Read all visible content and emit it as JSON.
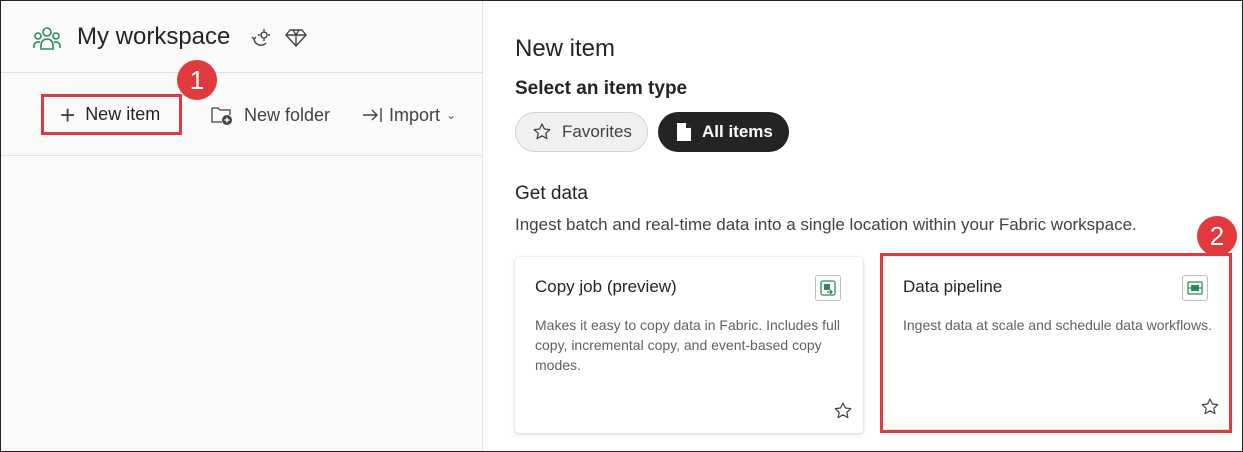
{
  "workspace": {
    "title": "My workspace",
    "icons": [
      "people-group-icon",
      "sync-icon",
      "diamond-icon"
    ]
  },
  "toolbar": {
    "new_item_label": "New item",
    "new_folder_label": "New folder",
    "import_label": "Import"
  },
  "callouts": {
    "badge_1": "1",
    "badge_2": "2"
  },
  "panel": {
    "title": "New item",
    "subtitle": "Select an item type",
    "filters": {
      "favorites_label": "Favorites",
      "all_items_label": "All items",
      "selected": "All items"
    }
  },
  "section": {
    "title": "Get data",
    "description": "Ingest batch and real-time data into a single location within your Fabric workspace."
  },
  "cards": [
    {
      "title": "Copy job (preview)",
      "description": "Makes it easy to copy data in Fabric. Includes full copy, incremental copy, and event-based copy modes.",
      "icon": "copy-job-icon"
    },
    {
      "title": "Data pipeline",
      "description": "Ingest data at scale and schedule data workflows.",
      "icon": "data-pipeline-icon"
    }
  ],
  "colors": {
    "highlight": "#e0393e",
    "accent_green": "#2e8b57",
    "pill_selected": "#242424"
  }
}
